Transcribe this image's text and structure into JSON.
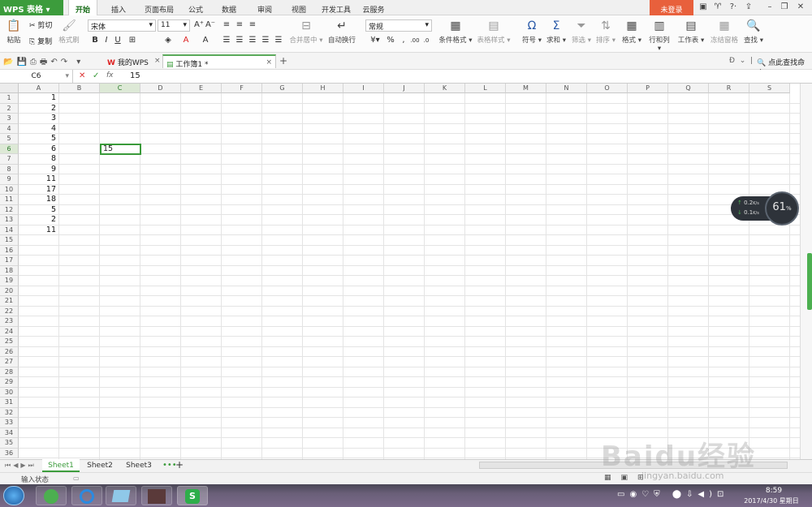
{
  "app": {
    "name": "WPS 表格",
    "login": "未登录"
  },
  "menu_tabs": [
    "开始",
    "插入",
    "页面布局",
    "公式",
    "数据",
    "审阅",
    "视图",
    "开发工具",
    "云服务"
  ],
  "ribbon": {
    "clipboard": {
      "paste": "粘贴",
      "cut": "剪切",
      "copy": "复制",
      "format_painter": "格式刷"
    },
    "font": {
      "name": "宋体",
      "size": "11"
    },
    "merge": "合并居中",
    "wrap": "自动换行",
    "number_format": "常规",
    "cond_format": "条件格式",
    "table_style": "表格样式",
    "symbol": "符号",
    "sum": "求和",
    "filter": "筛选",
    "sort": "排序",
    "format": "格式",
    "row_col": "行和列",
    "worksheet": "工作表",
    "freeze": "冻结窗格",
    "find": "查找"
  },
  "doc_tabs": [
    {
      "label": "我的WPS"
    },
    {
      "label": "工作簿1 *"
    }
  ],
  "search_cmd": "点此查找命令",
  "formula_bar": {
    "name_box": "C6",
    "fx": "fx",
    "value": "15"
  },
  "columns": [
    "A",
    "B",
    "C",
    "D",
    "E",
    "F",
    "G",
    "H",
    "I",
    "J",
    "K",
    "L",
    "M",
    "N",
    "O",
    "P",
    "Q",
    "R",
    "S"
  ],
  "rows": 36,
  "column_a": [
    "1",
    "2",
    "3",
    "4",
    "5",
    "6",
    "8",
    "9",
    "11",
    "17",
    "18",
    "5",
    "2",
    "11"
  ],
  "active_cell": {
    "ref": "C6",
    "value": "15"
  },
  "sheets": [
    "Sheet1",
    "Sheet2",
    "Sheet3"
  ],
  "status": "输入状态",
  "net_widget": {
    "up": "0.2",
    "down": "0.1",
    "unit": "K/s",
    "percent": "61",
    "pct_sign": "%"
  },
  "clock": {
    "time": "8:59",
    "date": "2017/4/30 星期日"
  },
  "watermark": "Baidu经验",
  "watermark_url": "jingyan.baidu.com",
  "colors": {
    "accent": "#3c9c3c",
    "login": "#e8603c"
  }
}
